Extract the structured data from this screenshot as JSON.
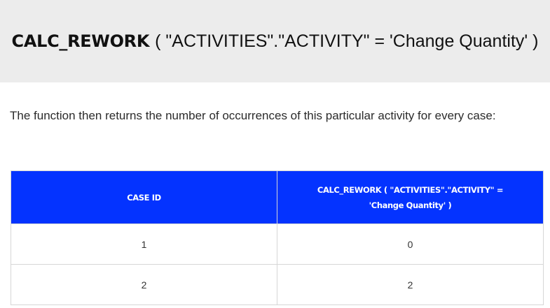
{
  "banner": {
    "function_name": "CALC_REWORK",
    "arguments": "( \"ACTIVITIES\".\"ACTIVITY\" = 'Change Quantity' )"
  },
  "description": "The function then returns the number of occurrences of this particular activity for every case:",
  "table": {
    "header_color": "#0433ff",
    "columns": [
      "CASE ID",
      "CALC_REWORK ( \"ACTIVITIES\".\"ACTIVITY\" = 'Change Quantity' )"
    ],
    "rows": [
      [
        "1",
        "0"
      ],
      [
        "2",
        "2"
      ]
    ]
  }
}
